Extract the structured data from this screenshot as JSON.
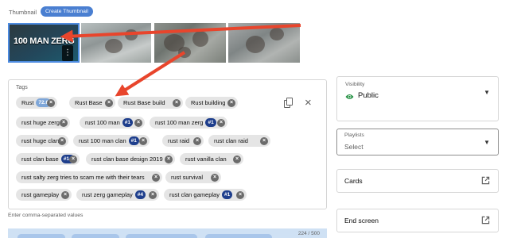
{
  "thumbnail": {
    "label": "Thumbnail",
    "create_button": "Create Thumbnail",
    "selected_text": "100 MAN ZERG",
    "more_glyph": "⋮"
  },
  "tags": {
    "title": "Tags",
    "hint": "Enter comma-separated values",
    "counter": "224 / 500",
    "remove_glyph": "×",
    "clear_glyph": "×",
    "items": [
      {
        "label": "Rust",
        "badge": "72.6",
        "badge_style": "light"
      },
      {
        "label": "Rust Base"
      },
      {
        "label": "Rust Base build"
      },
      {
        "label": "Rust building"
      },
      {
        "label": "rust huge zerg"
      },
      {
        "label": "rust 100 man",
        "badge": "#1",
        "badge_style": "dark"
      },
      {
        "label": "rust 100 man zerg",
        "badge": "#1",
        "badge_style": "dark"
      },
      {
        "label": "rust huge clan"
      },
      {
        "label": "rust 100 man clan",
        "badge": "#1",
        "badge_style": "dark"
      },
      {
        "label": "rust raid"
      },
      {
        "label": "rust clan raid"
      },
      {
        "label": "rust clan base",
        "badge": "#14",
        "badge_style": "dark"
      },
      {
        "label": "rust clan base design 2019"
      },
      {
        "label": "rust vanilla clan"
      },
      {
        "label": "rust salty zerg tries to scam me with their tears"
      },
      {
        "label": "rust survival"
      },
      {
        "label": "rust gameplay"
      },
      {
        "label": "rust zerg gameplay",
        "badge": "#4",
        "badge_style": "dark"
      },
      {
        "label": "rust clan gameplay",
        "badge": "#1",
        "badge_style": "dark"
      }
    ]
  },
  "visibility": {
    "label": "Visibility",
    "value": "Public",
    "icon": "eye-icon"
  },
  "playlists": {
    "label": "Playlists",
    "value": "Select",
    "icon": "caret-down-icon"
  },
  "cards": {
    "label": "Cards",
    "icon": "external-link-icon"
  },
  "end_screen": {
    "label": "End screen",
    "icon": "external-link-icon"
  },
  "colors": {
    "accent": "#4a7fd1",
    "badge_dark": "#1e3e8c",
    "badge_light": "#7ea6d8",
    "annotation_arrow": "#e8452c",
    "eye_green": "#1e8e3e"
  }
}
